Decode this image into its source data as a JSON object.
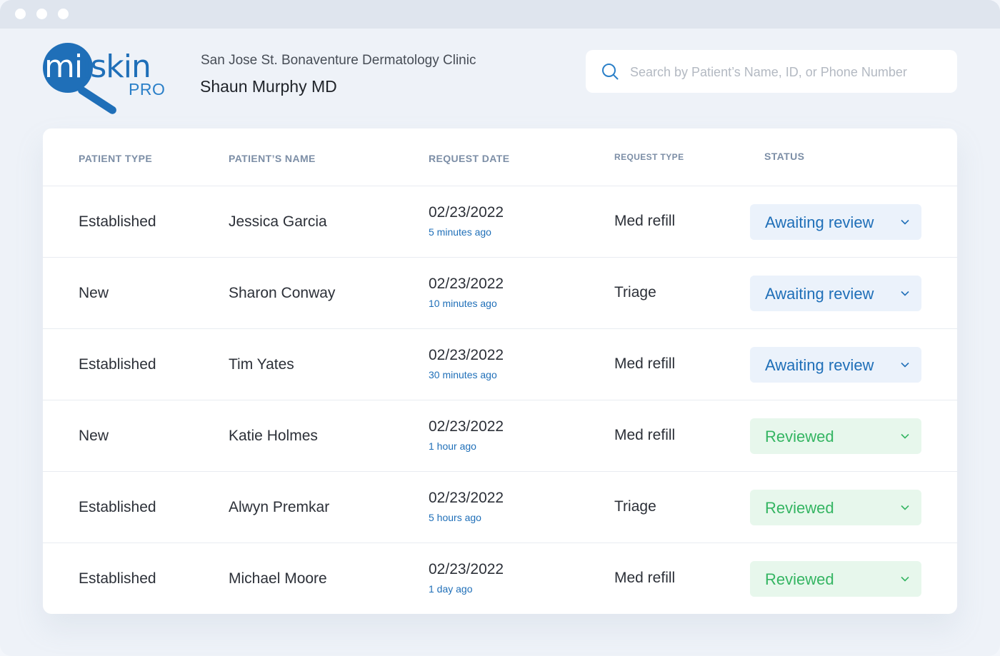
{
  "window": {
    "title": ""
  },
  "brand": {
    "logo_text_mi": "mi",
    "logo_text_rest": "iskin",
    "logo_suffix": "PRO",
    "logo_color": "#1f6fb8"
  },
  "header": {
    "clinic_name": "San Jose St. Bonaventure Dermatology Clinic",
    "doctor_name": "Shaun Murphy MD"
  },
  "search": {
    "placeholder": "Search by Patient’s Name, ID, or Phone Number",
    "value": "",
    "icon": "search-icon"
  },
  "table": {
    "columns": [
      "PATIENT TYPE",
      "PATIENT’S NAME",
      "REQUEST DATE",
      "REQUEST TYPE",
      "STATUS"
    ],
    "rows": [
      {
        "patient_type": "Established",
        "name": "Jessica Garcia",
        "date": "02/23/2022",
        "ago": "5 minutes ago",
        "request_type": "Med refill",
        "status": "Awaiting review",
        "status_kind": "await"
      },
      {
        "patient_type": "New",
        "name": "Sharon Conway",
        "date": "02/23/2022",
        "ago": "10 minutes ago",
        "request_type": "Triage",
        "status": "Awaiting review",
        "status_kind": "await"
      },
      {
        "patient_type": "Established",
        "name": "Tim Yates",
        "date": "02/23/2022",
        "ago": "30 minutes ago",
        "request_type": "Med refill",
        "status": "Awaiting review",
        "status_kind": "await"
      },
      {
        "patient_type": "New",
        "name": "Katie Holmes",
        "date": "02/23/2022",
        "ago": "1 hour ago",
        "request_type": "Med refill",
        "status": "Reviewed",
        "status_kind": "rev"
      },
      {
        "patient_type": "Established",
        "name": "Alwyn Premkar",
        "date": "02/23/2022",
        "ago": "5 hours ago",
        "request_type": "Triage",
        "status": "Reviewed",
        "status_kind": "rev"
      },
      {
        "patient_type": "Established",
        "name": "Michael Moore",
        "date": "02/23/2022",
        "ago": "1 day ago",
        "request_type": "Med refill",
        "status": "Reviewed",
        "status_kind": "rev"
      }
    ]
  },
  "colors": {
    "awaiting": "#1f6fb8",
    "awaiting_bg": "#ebf2fb",
    "reviewed": "#34b562",
    "reviewed_bg": "#e7f7ec"
  }
}
